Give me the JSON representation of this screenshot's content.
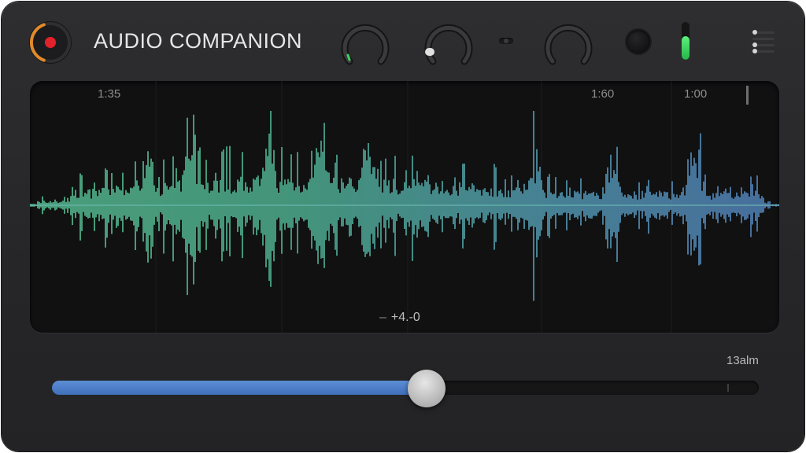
{
  "app": {
    "title": "AUDIO COMPANION"
  },
  "colors": {
    "record": "#e0222b",
    "record_ring": "#e08a2a",
    "waveform_start": "#5fd0a0",
    "waveform_end": "#5b8fcf",
    "progress_fill": "#4a7cc6",
    "meter_green": "#3ed25e"
  },
  "toolbar": {
    "knobs": [
      {
        "name": "knob-1",
        "level": 0.18,
        "indicator": "green"
      },
      {
        "name": "knob-2",
        "level": 0.0,
        "indicator": "white"
      },
      {
        "name": "knob-3",
        "level": 0.5,
        "indicator": "none"
      }
    ],
    "meter_level": 0.62,
    "icons": [
      "record-icon",
      "toggle-icon",
      "stop-icon",
      "menu-icon"
    ]
  },
  "timeline": {
    "labels": [
      "1:35",
      "1:60",
      "1:00"
    ],
    "level_readout": "+4.-0"
  },
  "transport": {
    "duration": "13alm",
    "progress": 0.53
  }
}
